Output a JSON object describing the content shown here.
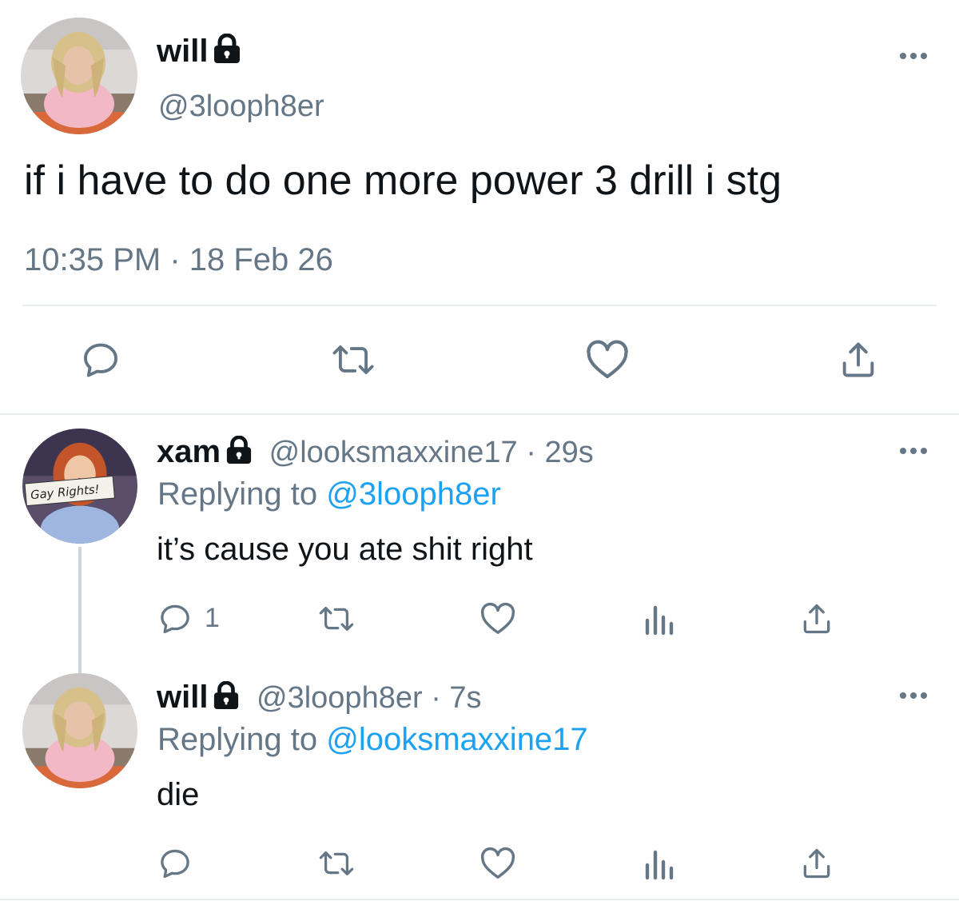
{
  "main_tweet": {
    "name": "will",
    "handle": "@3looph8er",
    "text": "if i have to do one more power 3 drill i stg",
    "timestamp": "10:35 PM · 18 Feb 26",
    "actions": [
      "reply-icon",
      "retweet-icon",
      "like-icon",
      "share-icon"
    ]
  },
  "replies": [
    {
      "name": "xam",
      "handle": "@looksmaxxine17",
      "separator": "·",
      "time": "29s",
      "replying_prefix": "Replying to",
      "replying_to": "@3looph8er",
      "text": "it’s cause you ate shit right",
      "reply_count": "1",
      "avatar_sign_text": "Gay Rights!"
    },
    {
      "name": "will",
      "handle": "@3looph8er",
      "separator": "·",
      "time": "7s",
      "replying_prefix": "Replying to",
      "replying_to": "@looksmaxxine17",
      "text": "die",
      "reply_count": ""
    }
  ],
  "colors": {
    "text": "#0f1419",
    "secondary": "#657786",
    "link": "#1da1f2",
    "divider": "#e6ecf0"
  }
}
